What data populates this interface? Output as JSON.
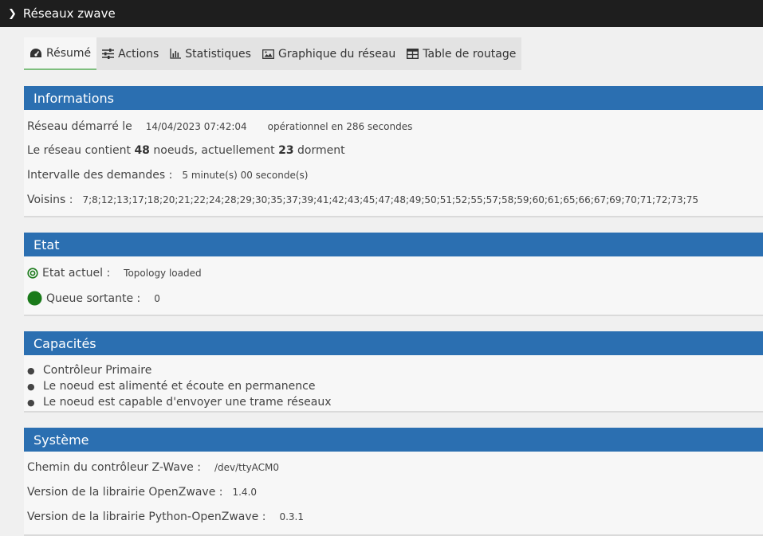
{
  "header": {
    "title": "Réseaux zwave",
    "chevron_icon": "chevron-right-icon"
  },
  "tabs": [
    {
      "label": "Résumé",
      "icon": "dashboard-icon",
      "active": true
    },
    {
      "label": "Actions",
      "icon": "sliders-icon"
    },
    {
      "label": "Statistiques",
      "icon": "bar-chart-icon"
    },
    {
      "label": "Graphique du réseau",
      "icon": "image-icon"
    },
    {
      "label": "Table de routage",
      "icon": "table-icon"
    }
  ],
  "informations": {
    "title": "Informations",
    "started_label": "Réseau démarré le",
    "started_value": "14/04/2023 07:42:04",
    "operational": "opérationnel en 286 secondes",
    "contains_prefix": "Le réseau contient",
    "nodes": "48",
    "nodes_mid": "noeuds, actuellement",
    "sleeping": "23",
    "sleeping_suffix": "dorment",
    "interval_label": "Intervalle des demandes :",
    "interval_value": "5 minute(s) 00 seconde(s)",
    "neighbors_label": "Voisins :",
    "neighbors_value": "7;8;12;13;17;18;20;21;22;24;28;29;30;35;37;39;41;42;43;45;47;48;49;50;51;52;55;57;58;59;60;61;65;66;67;69;70;71;72;73;75"
  },
  "etat": {
    "title": "Etat",
    "current_label": "Etat actuel :",
    "current_value": "Topology loaded",
    "queue_label": "Queue sortante :",
    "queue_value": "0",
    "status_color": "#1a7a1a"
  },
  "capacites": {
    "title": "Capacités",
    "items": [
      "Contrôleur Primaire",
      "Le noeud est alimenté et écoute en permanence",
      "Le noeud est capable d'envoyer une trame réseaux"
    ]
  },
  "systeme": {
    "title": "Système",
    "path_label": "Chemin du contrôleur Z-Wave :",
    "path_value": "/dev/ttyACM0",
    "openzwave_label": "Version de la librairie OpenZwave :",
    "openzwave_value": "1.4.0",
    "python_label": "Version de la librairie Python-OpenZwave :",
    "python_value": "0.3.1"
  },
  "colors": {
    "accent": "#2b6fb1",
    "titlebar": "#1e1e1e",
    "ok": "#1a7a1a"
  }
}
